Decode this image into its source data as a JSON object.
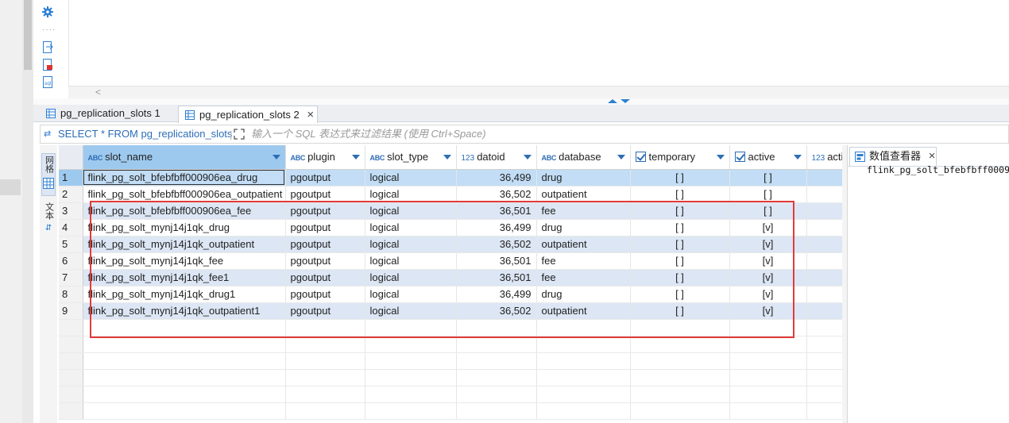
{
  "editor": {
    "hscroll_glyph": "<"
  },
  "result_tabs": [
    {
      "label": "pg_replication_slots 1",
      "active": false
    },
    {
      "label": "pg_replication_slots 2",
      "active": true,
      "close": "×"
    }
  ],
  "filter": {
    "query": "SELECT * FROM pg_replication_slots",
    "placeholder": "输入一个 SQL 表达式来过滤结果 (使用 Ctrl+Space)"
  },
  "side_tabs": {
    "grid_label": "网格",
    "text_label": "文本"
  },
  "columns": [
    {
      "name": "slot_name",
      "type": "ABC"
    },
    {
      "name": "plugin",
      "type": "ABC"
    },
    {
      "name": "slot_type",
      "type": "ABC"
    },
    {
      "name": "datoid",
      "type": "123"
    },
    {
      "name": "database",
      "type": "ABC"
    },
    {
      "name": "temporary",
      "type": "check"
    },
    {
      "name": "active",
      "type": "check"
    },
    {
      "name": "activ",
      "type": "123"
    }
  ],
  "rows": [
    [
      "1",
      "flink_pg_solt_bfebfbff000906ea_drug",
      "pgoutput",
      "logical",
      "36,499",
      "drug",
      "[ ]",
      "[ ]"
    ],
    [
      "2",
      "flink_pg_solt_bfebfbff000906ea_outpatient",
      "pgoutput",
      "logical",
      "36,502",
      "outpatient",
      "[ ]",
      "[ ]"
    ],
    [
      "3",
      "flink_pg_solt_bfebfbff000906ea_fee",
      "pgoutput",
      "logical",
      "36,501",
      "fee",
      "[ ]",
      "[ ]"
    ],
    [
      "4",
      "flink_pg_solt_mynj14j1qk_drug",
      "pgoutput",
      "logical",
      "36,499",
      "drug",
      "[ ]",
      "[v]"
    ],
    [
      "5",
      "flink_pg_solt_mynj14j1qk_outpatient",
      "pgoutput",
      "logical",
      "36,502",
      "outpatient",
      "[ ]",
      "[v]"
    ],
    [
      "6",
      "flink_pg_solt_mynj14j1qk_fee",
      "pgoutput",
      "logical",
      "36,501",
      "fee",
      "[ ]",
      "[v]"
    ],
    [
      "7",
      "flink_pg_solt_mynj14j1qk_fee1",
      "pgoutput",
      "logical",
      "36,501",
      "fee",
      "[ ]",
      "[v]"
    ],
    [
      "8",
      "flink_pg_solt_mynj14j1qk_drug1",
      "pgoutput",
      "logical",
      "36,499",
      "drug",
      "[ ]",
      "[v]"
    ],
    [
      "9",
      "flink_pg_solt_mynj14j1qk_outpatient1",
      "pgoutput",
      "logical",
      "36,502",
      "outpatient",
      "[ ]",
      "[v]"
    ]
  ],
  "value_panel": {
    "title": "数值查看器",
    "close": "×",
    "value": "flink_pg_solt_bfebfbff0009"
  },
  "colors": {
    "accent": "#2d6db5",
    "highlight_box": "#e23a3a",
    "row_alt": "#dce6f4",
    "row_selected": "#c2ddf5"
  }
}
